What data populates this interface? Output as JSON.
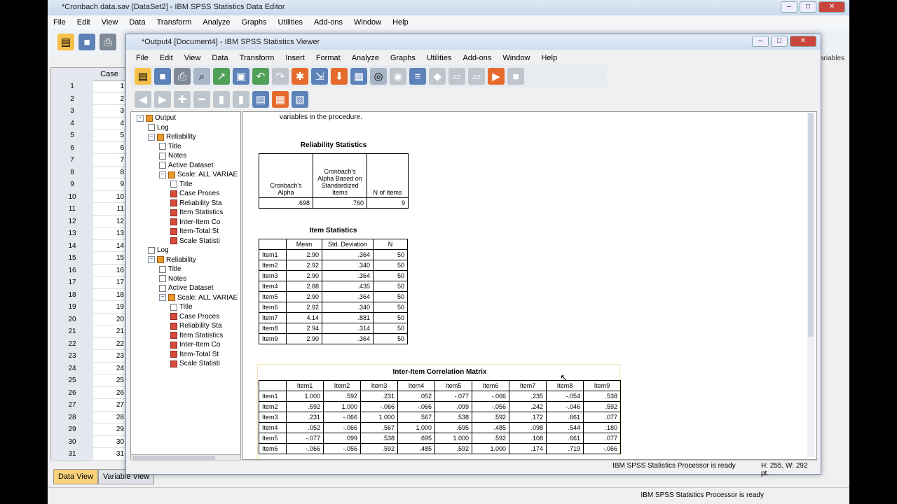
{
  "editor": {
    "title": "*Cronbach data.sav [DataSet2] - IBM SPSS Statistics Data Editor",
    "menu": [
      "File",
      "Edit",
      "View",
      "Data",
      "Transform",
      "Analyze",
      "Graphs",
      "Utilities",
      "Add-ons",
      "Window",
      "Help"
    ],
    "case_header": "Case",
    "rows": [
      "1",
      "2",
      "3",
      "4",
      "5",
      "6",
      "7",
      "8",
      "9",
      "10",
      "11",
      "12",
      "13",
      "14",
      "15",
      "16",
      "17",
      "18",
      "19",
      "20",
      "21",
      "22",
      "23",
      "24",
      "25",
      "26",
      "27",
      "28",
      "29",
      "30",
      "31"
    ],
    "case_values": [
      "1",
      "2",
      "3",
      "4",
      "5",
      "6",
      "7",
      "8",
      "9",
      "10",
      "11",
      "12",
      "13",
      "14",
      "15",
      "16",
      "17",
      "18",
      "19",
      "20",
      "21",
      "22",
      "23",
      "24",
      "25",
      "26",
      "27",
      "28",
      "29",
      "30",
      "31"
    ],
    "tabs": [
      "Data View",
      "Variable View"
    ],
    "status": "IBM SPSS Statistics Processor is ready",
    "variables_fragment": "ariables"
  },
  "viewer": {
    "title": "*Output4 [Document4] - IBM SPSS Statistics Viewer",
    "menu": [
      "File",
      "Edit",
      "View",
      "Data",
      "Transform",
      "Insert",
      "Format",
      "Analyze",
      "Graphs",
      "Utilities",
      "Add-ons",
      "Window",
      "Help"
    ],
    "outline": [
      {
        "label": "Output",
        "indent": 0,
        "icon": "book"
      },
      {
        "label": "Log",
        "indent": 1,
        "icon": "note"
      },
      {
        "label": "Reliability",
        "indent": 1,
        "icon": "book"
      },
      {
        "label": "Title",
        "indent": 2,
        "icon": "note"
      },
      {
        "label": "Notes",
        "indent": 2,
        "icon": "note"
      },
      {
        "label": "Active Dataset",
        "indent": 2,
        "icon": "note"
      },
      {
        "label": "Scale: ALL VARIAE",
        "indent": 2,
        "icon": "book"
      },
      {
        "label": "Title",
        "indent": 3,
        "icon": "note"
      },
      {
        "label": "Case Proces",
        "indent": 3,
        "icon": "red"
      },
      {
        "label": "Reliability Sta",
        "indent": 3,
        "icon": "red"
      },
      {
        "label": "Item Statistics",
        "indent": 3,
        "icon": "red"
      },
      {
        "label": "Inter-Item Co",
        "indent": 3,
        "icon": "red"
      },
      {
        "label": "Item-Total St",
        "indent": 3,
        "icon": "red"
      },
      {
        "label": "Scale Statisti",
        "indent": 3,
        "icon": "red"
      },
      {
        "label": "Log",
        "indent": 1,
        "icon": "note"
      },
      {
        "label": "Reliability",
        "indent": 1,
        "icon": "book"
      },
      {
        "label": "Title",
        "indent": 2,
        "icon": "note"
      },
      {
        "label": "Notes",
        "indent": 2,
        "icon": "note"
      },
      {
        "label": "Active Dataset",
        "indent": 2,
        "icon": "note"
      },
      {
        "label": "Scale: ALL VARIAE",
        "indent": 2,
        "icon": "book"
      },
      {
        "label": "Title",
        "indent": 3,
        "icon": "note"
      },
      {
        "label": "Case Proces",
        "indent": 3,
        "icon": "red"
      },
      {
        "label": "Reliability Sta",
        "indent": 3,
        "icon": "red"
      },
      {
        "label": "Item Statistics",
        "indent": 3,
        "icon": "red"
      },
      {
        "label": "Inter-Item Co",
        "indent": 3,
        "icon": "red"
      },
      {
        "label": "Item-Total St",
        "indent": 3,
        "icon": "red"
      },
      {
        "label": "Scale Statisti",
        "indent": 3,
        "icon": "red"
      }
    ],
    "content_intro": "variables in the procedure.",
    "reliability": {
      "caption": "Reliability Statistics",
      "headers": [
        "Cronbach's Alpha",
        "Cronbach's Alpha Based on Standardized Items",
        "N of Items"
      ],
      "values": [
        ".698",
        ".760",
        "9"
      ]
    },
    "item_stats": {
      "caption": "Item Statistics",
      "headers": [
        "Mean",
        "Std. Deviation",
        "N"
      ],
      "rows": [
        [
          "Item1",
          "2.90",
          ".364",
          "50"
        ],
        [
          "Item2",
          "2.92",
          ".340",
          "50"
        ],
        [
          "Item3",
          "2.90",
          ".364",
          "50"
        ],
        [
          "Item4",
          "2.88",
          ".435",
          "50"
        ],
        [
          "Item5",
          "2.90",
          ".364",
          "50"
        ],
        [
          "Item6",
          "2.92",
          ".340",
          "50"
        ],
        [
          "Item7",
          "4.14",
          ".881",
          "50"
        ],
        [
          "Item8",
          "2.94",
          ".314",
          "50"
        ],
        [
          "Item9",
          "2.90",
          ".364",
          "50"
        ]
      ]
    },
    "corr": {
      "caption": "Inter-Item Correlation Matrix",
      "headers": [
        "Item1",
        "Item2",
        "Item3",
        "Item4",
        "Item5",
        "Item6",
        "Item7",
        "Item8",
        "Item9"
      ],
      "rows": [
        [
          "Item1",
          "1.000",
          ".592",
          ".231",
          ".052",
          "-.077",
          "-.066",
          ".235",
          "-.054",
          ".538"
        ],
        [
          "Item2",
          ".592",
          "1.000",
          "-.066",
          "-.066",
          ".099",
          "-.056",
          ".242",
          "-.046",
          ".592"
        ],
        [
          "Item3",
          ".231",
          "-.066",
          "1.000",
          ".567",
          ".538",
          ".592",
          ".172",
          ".661",
          ".077"
        ],
        [
          "Item4",
          ".052",
          "-.066",
          ".567",
          "1.000",
          ".695",
          ".485",
          ".098",
          ".544",
          ".180"
        ],
        [
          "Item5",
          "-.077",
          ".099",
          ".538",
          ".695",
          "1.000",
          ".592",
          ".108",
          ".661",
          ".077"
        ],
        [
          "Item6",
          "-.066",
          "-.056",
          ".592",
          ".485",
          ".592",
          "1.000",
          ".174",
          ".719",
          "-.066"
        ]
      ]
    },
    "status_left": "IBM SPSS Statistics Processor is ready",
    "status_right": "H: 255, W: 292 pt."
  }
}
